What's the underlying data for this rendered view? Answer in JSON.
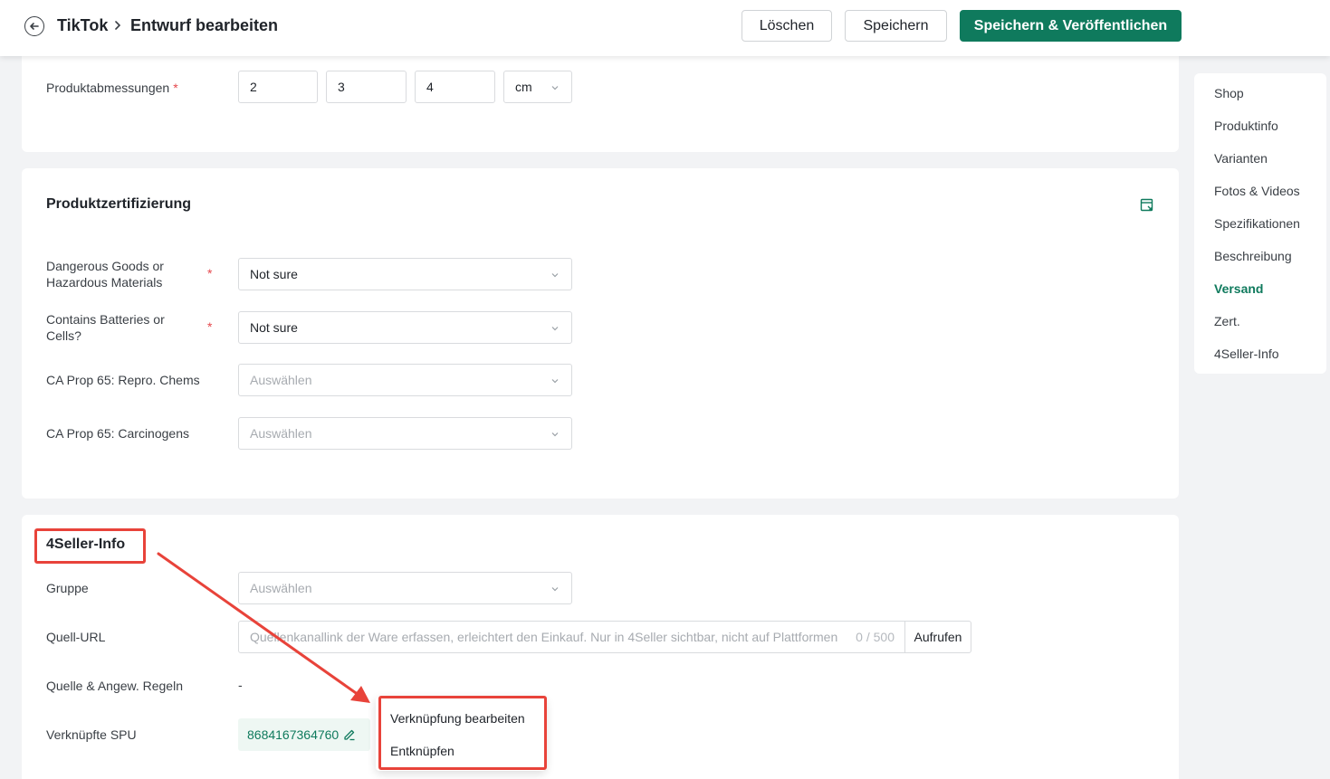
{
  "header": {
    "breadcrumb_app": "TikTok",
    "breadcrumb_page": "Entwurf bearbeiten",
    "delete_label": "Löschen",
    "save_label": "Speichern",
    "publish_label": "Speichern & Veröffentlichen"
  },
  "dimensions": {
    "label": "Produktabmessungen",
    "required_mark": "*",
    "length": "2",
    "width": "3",
    "height": "4",
    "unit": "cm"
  },
  "certification": {
    "title": "Produktzertifizierung",
    "fields": [
      {
        "label_line1": "Dangerous Goods or",
        "label_line2": "Hazardous Materials",
        "required_mark": "*",
        "value": "Not sure"
      },
      {
        "label_line1": "Contains Batteries or",
        "label_line2": "Cells?",
        "required_mark": "*",
        "value": "Not sure"
      },
      {
        "label": "CA Prop 65: Repro. Chems",
        "placeholder": "Auswählen"
      },
      {
        "label": "CA Prop 65: Carcinogens",
        "placeholder": "Auswählen"
      }
    ]
  },
  "seller_info": {
    "title": "4Seller-Info",
    "group_label": "Gruppe",
    "group_placeholder": "Auswählen",
    "source_url_label": "Quell-URL",
    "source_url_placeholder": "Quellenkanallink der Ware erfassen, erleichtert den Einkauf. Nur in 4Seller sichtbar, nicht auf Plattformen",
    "source_url_counter": "0 / 500",
    "open_label": "Aufrufen",
    "rules_label": "Quelle & Angew. Regeln",
    "rules_value": "-",
    "spu_label": "Verknüpfte SPU",
    "spu_value": "8684167364760"
  },
  "popup": {
    "edit_link": "Verknüpfung bearbeiten",
    "unlink": "Entknüpfen"
  },
  "sidenav": {
    "items": [
      "Shop",
      "Produktinfo",
      "Varianten",
      "Fotos & Videos",
      "Spezifikationen",
      "Beschreibung",
      "Versand",
      "Zert.",
      "4Seller-Info"
    ],
    "active": "Versand"
  },
  "colors": {
    "accent": "#0f7a5d",
    "annotation": "#e8433a",
    "required": "#e5484d",
    "spu_badge_bg": "#eef7f3"
  }
}
